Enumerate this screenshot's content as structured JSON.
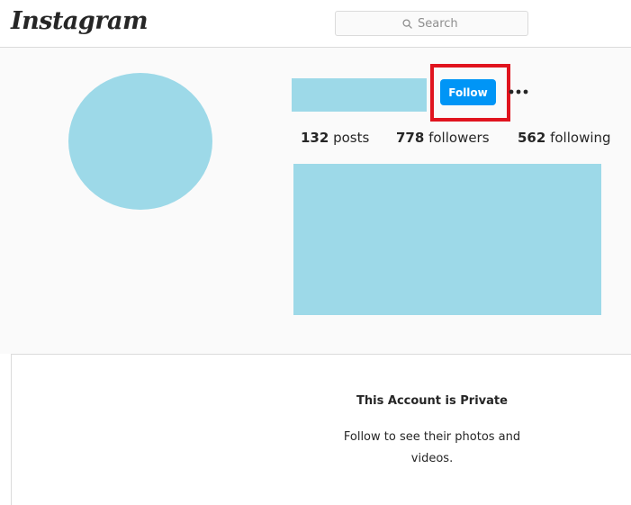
{
  "header": {
    "logo": "Instagram",
    "search_placeholder": "Search"
  },
  "profile": {
    "follow_label": "Follow",
    "more_label": "•••",
    "stats": {
      "posts_count": "132",
      "posts_label": "posts",
      "followers_count": "778",
      "followers_label": "followers",
      "following_count": "562",
      "following_label": "following"
    }
  },
  "private_account": {
    "title": "This Account is Private",
    "description": "Follow to see their photos and videos."
  },
  "colors": {
    "accent": "#0095f6",
    "highlight": "#e0141e",
    "placeholder_block": "#9dd9e8"
  },
  "icons": {
    "search": "search-icon",
    "more": "more-options-icon"
  }
}
